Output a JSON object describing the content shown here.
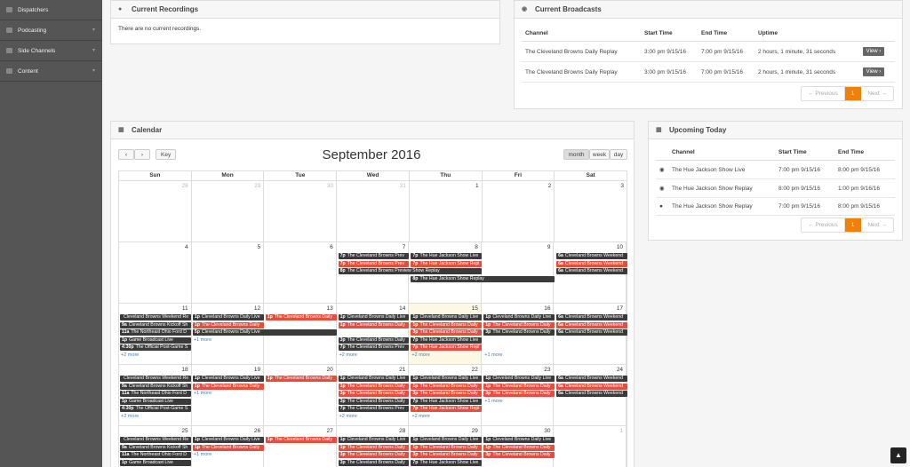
{
  "sidebar": {
    "items": [
      {
        "label": "Dispatchers",
        "icon": "dispatch-icon"
      },
      {
        "label": "Podcasting",
        "icon": "podcast-icon"
      },
      {
        "label": "Side Channels",
        "icon": "channel-icon"
      },
      {
        "label": "Content",
        "icon": "folder-icon"
      }
    ]
  },
  "recordings": {
    "title": "Current Recordings",
    "empty": "There are no current recordings."
  },
  "broadcasts": {
    "title": "Current Broadcasts",
    "headers": [
      "Channel",
      "Start Time",
      "End Time",
      "Uptime"
    ],
    "rows": [
      {
        "channel": "The Cleveland Browns Daily Replay",
        "start": "3:00 pm 9/15/16",
        "end": "7:00 pm 9/15/16",
        "uptime": "2 hours, 1 minute, 31 seconds",
        "action": "View"
      },
      {
        "channel": "The Cleveland Browns Daily Replay",
        "start": "3:00 pm 9/15/16",
        "end": "7:00 pm 9/15/16",
        "uptime": "2 hours, 1 minute, 31 seconds",
        "action": "View"
      }
    ],
    "pager": {
      "prev": "← Previous",
      "page": "1",
      "next": "Next →"
    }
  },
  "calendar": {
    "title": "Calendar",
    "month_title": "September 2016",
    "key_label": "Key",
    "prev": "‹",
    "next": "›",
    "views": [
      "month",
      "week",
      "day"
    ],
    "dow": [
      "Sun",
      "Mon",
      "Tue",
      "Wed",
      "Thu",
      "Fri",
      "Sat"
    ],
    "weeks": [
      [
        {
          "n": "28",
          "o": true
        },
        {
          "n": "29",
          "o": true
        },
        {
          "n": "30",
          "o": true
        },
        {
          "n": "31",
          "o": true
        },
        {
          "n": "1"
        },
        {
          "n": "2"
        },
        {
          "n": "3"
        }
      ],
      [
        {
          "n": "4"
        },
        {
          "n": "5"
        },
        {
          "n": "6"
        },
        {
          "n": "7"
        },
        {
          "n": "8"
        },
        {
          "n": "9"
        },
        {
          "n": "10"
        }
      ],
      [
        {
          "n": "11"
        },
        {
          "n": "12"
        },
        {
          "n": "13"
        },
        {
          "n": "14"
        },
        {
          "n": "15",
          "t": true
        },
        {
          "n": "16"
        },
        {
          "n": "17"
        }
      ],
      [
        {
          "n": "18"
        },
        {
          "n": "19"
        },
        {
          "n": "20"
        },
        {
          "n": "21"
        },
        {
          "n": "22"
        },
        {
          "n": "23"
        },
        {
          "n": "24"
        }
      ],
      [
        {
          "n": "25"
        },
        {
          "n": "26"
        },
        {
          "n": "27"
        },
        {
          "n": "28"
        },
        {
          "n": "29"
        },
        {
          "n": "30"
        },
        {
          "n": "1",
          "o": true
        }
      ]
    ],
    "events": [
      {
        "w": 1,
        "d": 3,
        "r": 0,
        "time": "7p",
        "text": "The Cleveland Browns Prev",
        "c": "dark"
      },
      {
        "w": 1,
        "d": 3,
        "r": 1,
        "time": "7p",
        "text": "The Cleveland Browns Prev",
        "c": "red"
      },
      {
        "w": 1,
        "d": 3,
        "r": 2,
        "time": "8p",
        "text": "The Cleveland Browns Preview Show Replay",
        "c": "dark",
        "span": 2
      },
      {
        "w": 1,
        "d": 4,
        "r": 0,
        "time": "7p",
        "text": "The Hue Jackson Show Live",
        "c": "dark"
      },
      {
        "w": 1,
        "d": 4,
        "r": 1,
        "time": "7p",
        "text": "The Hue Jackson Show Repl",
        "c": "red"
      },
      {
        "w": 1,
        "d": 4,
        "r": 3,
        "time": "8p",
        "text": "The Hue Jackson Show Replay",
        "c": "dark",
        "span": 2
      },
      {
        "w": 1,
        "d": 6,
        "r": 0,
        "time": "6a",
        "text": "Cleveland Browns Weekend",
        "c": "dark"
      },
      {
        "w": 1,
        "d": 6,
        "r": 1,
        "time": "6a",
        "text": "Cleveland Browns Weekend",
        "c": "red"
      },
      {
        "w": 1,
        "d": 6,
        "r": 2,
        "time": "6a",
        "text": "Cleveland Browns Weekend",
        "c": "dark"
      },
      {
        "w": 2,
        "d": 0,
        "r": 0,
        "time": "",
        "text": "Cleveland Browns Weekend Re",
        "c": "dark"
      },
      {
        "w": 2,
        "d": 0,
        "r": 1,
        "time": "9a",
        "text": "Cleveland Browns Kickoff Sh",
        "c": "dark"
      },
      {
        "w": 2,
        "d": 0,
        "r": 2,
        "time": "11a",
        "text": "The Northeast Ohio Ford D",
        "c": "dark"
      },
      {
        "w": 2,
        "d": 0,
        "r": 3,
        "time": "1p",
        "text": "Game Broadcast Live",
        "c": "dark"
      },
      {
        "w": 2,
        "d": 0,
        "r": 4,
        "time": "4:30p",
        "text": "The Official Post-Game S",
        "c": "dark"
      },
      {
        "w": 2,
        "d": 1,
        "r": 0,
        "time": "1p",
        "text": "Cleveland Browns Daily Live",
        "c": "dark"
      },
      {
        "w": 2,
        "d": 1,
        "r": 1,
        "time": "1p",
        "text": "The Cleveland Browns Daily",
        "c": "red"
      },
      {
        "w": 2,
        "d": 1,
        "r": 2,
        "time": "5p",
        "text": "Cleveland Browns Daily Live",
        "c": "dark",
        "span": 2
      },
      {
        "w": 2,
        "d": 2,
        "r": 0,
        "time": "1p",
        "text": "The Cleveland Browns Daily",
        "c": "red"
      },
      {
        "w": 2,
        "d": 3,
        "r": 0,
        "time": "1p",
        "text": "Cleveland Browns Daily Live",
        "c": "dark"
      },
      {
        "w": 2,
        "d": 3,
        "r": 1,
        "time": "1p",
        "text": "The Cleveland Browns Daily",
        "c": "red"
      },
      {
        "w": 2,
        "d": 3,
        "r": 3,
        "time": "3p",
        "text": "The Cleveland Browns Daily",
        "c": "dark"
      },
      {
        "w": 2,
        "d": 3,
        "r": 4,
        "time": "7p",
        "text": "The Cleveland Browns Prev",
        "c": "dark"
      },
      {
        "w": 2,
        "d": 4,
        "r": 0,
        "time": "1p",
        "text": "Cleveland Browns Daily Live",
        "c": "dark"
      },
      {
        "w": 2,
        "d": 4,
        "r": 1,
        "time": "1p",
        "text": "The Cleveland Browns Daily",
        "c": "red"
      },
      {
        "w": 2,
        "d": 4,
        "r": 2,
        "time": "3p",
        "text": "The Cleveland Browns Daily",
        "c": "red"
      },
      {
        "w": 2,
        "d": 4,
        "r": 3,
        "time": "7p",
        "text": "The Hue Jackson Show Live",
        "c": "dark"
      },
      {
        "w": 2,
        "d": 4,
        "r": 4,
        "time": "7p",
        "text": "The Hue Jackson Show Repl",
        "c": "red"
      },
      {
        "w": 2,
        "d": 5,
        "r": 0,
        "time": "1p",
        "text": "Cleveland Browns Daily Live",
        "c": "dark"
      },
      {
        "w": 2,
        "d": 5,
        "r": 1,
        "time": "1p",
        "text": "The Cleveland Browns Daily",
        "c": "red"
      },
      {
        "w": 2,
        "d": 5,
        "r": 2,
        "time": "3p",
        "text": "The Cleveland Browns Daily",
        "c": "dark"
      },
      {
        "w": 2,
        "d": 6,
        "r": 0,
        "time": "6a",
        "text": "Cleveland Browns Weekend",
        "c": "dark"
      },
      {
        "w": 2,
        "d": 6,
        "r": 1,
        "time": "6a",
        "text": "Cleveland Browns Weekend",
        "c": "red"
      },
      {
        "w": 2,
        "d": 6,
        "r": 2,
        "time": "6a",
        "text": "Cleveland Browns Weekend",
        "c": "dark"
      },
      {
        "w": 3,
        "d": 0,
        "r": 0,
        "time": "",
        "text": "Cleveland Browns Weekend Re",
        "c": "dark"
      },
      {
        "w": 3,
        "d": 0,
        "r": 1,
        "time": "9a",
        "text": "Cleveland Browns Kickoff Sh",
        "c": "dark"
      },
      {
        "w": 3,
        "d": 0,
        "r": 2,
        "time": "11a",
        "text": "The Northeast Ohio Ford D",
        "c": "dark"
      },
      {
        "w": 3,
        "d": 0,
        "r": 3,
        "time": "1p",
        "text": "Game Broadcast Live",
        "c": "dark"
      },
      {
        "w": 3,
        "d": 0,
        "r": 4,
        "time": "4:30p",
        "text": "The Official Post-Game S",
        "c": "dark"
      },
      {
        "w": 3,
        "d": 1,
        "r": 0,
        "time": "1p",
        "text": "Cleveland Browns Daily Live",
        "c": "dark"
      },
      {
        "w": 3,
        "d": 1,
        "r": 1,
        "time": "1p",
        "text": "The Cleveland Browns Daily",
        "c": "red"
      },
      {
        "w": 3,
        "d": 2,
        "r": 0,
        "time": "1p",
        "text": "The Cleveland Browns Daily",
        "c": "red"
      },
      {
        "w": 3,
        "d": 3,
        "r": 0,
        "time": "1p",
        "text": "Cleveland Browns Daily Live",
        "c": "dark"
      },
      {
        "w": 3,
        "d": 3,
        "r": 1,
        "time": "1p",
        "text": "The Cleveland Browns Daily",
        "c": "red"
      },
      {
        "w": 3,
        "d": 3,
        "r": 2,
        "time": "3p",
        "text": "The Cleveland Browns Daily",
        "c": "red"
      },
      {
        "w": 3,
        "d": 3,
        "r": 3,
        "time": "3p",
        "text": "The Cleveland Browns Daily",
        "c": "dark"
      },
      {
        "w": 3,
        "d": 3,
        "r": 4,
        "time": "7p",
        "text": "The Cleveland Browns Prev",
        "c": "dark"
      },
      {
        "w": 3,
        "d": 4,
        "r": 0,
        "time": "1p",
        "text": "Cleveland Browns Daily Live",
        "c": "dark"
      },
      {
        "w": 3,
        "d": 4,
        "r": 1,
        "time": "1p",
        "text": "The Cleveland Browns Daily",
        "c": "red"
      },
      {
        "w": 3,
        "d": 4,
        "r": 2,
        "time": "3p",
        "text": "The Cleveland Browns Daily",
        "c": "red"
      },
      {
        "w": 3,
        "d": 4,
        "r": 3,
        "time": "7p",
        "text": "The Hue Jackson Show Live",
        "c": "dark"
      },
      {
        "w": 3,
        "d": 4,
        "r": 4,
        "time": "7p",
        "text": "The Hue Jackson Show Repl",
        "c": "red"
      },
      {
        "w": 3,
        "d": 5,
        "r": 0,
        "time": "1p",
        "text": "Cleveland Browns Daily Live",
        "c": "dark"
      },
      {
        "w": 3,
        "d": 5,
        "r": 1,
        "time": "1p",
        "text": "The Cleveland Browns Daily",
        "c": "red"
      },
      {
        "w": 3,
        "d": 5,
        "r": 2,
        "time": "3p",
        "text": "The Cleveland Browns Daily",
        "c": "red"
      },
      {
        "w": 3,
        "d": 6,
        "r": 0,
        "time": "6a",
        "text": "Cleveland Browns Weekend",
        "c": "dark"
      },
      {
        "w": 3,
        "d": 6,
        "r": 1,
        "time": "6a",
        "text": "Cleveland Browns Weekend",
        "c": "red"
      },
      {
        "w": 3,
        "d": 6,
        "r": 2,
        "time": "6a",
        "text": "Cleveland Browns Weekend",
        "c": "dark"
      },
      {
        "w": 4,
        "d": 0,
        "r": 0,
        "time": "",
        "text": "Cleveland Browns Weekend Re",
        "c": "dark"
      },
      {
        "w": 4,
        "d": 0,
        "r": 1,
        "time": "9a",
        "text": "Cleveland Browns Kickoff Sh",
        "c": "dark"
      },
      {
        "w": 4,
        "d": 0,
        "r": 2,
        "time": "11a",
        "text": "The Northeast Ohio Ford D",
        "c": "dark"
      },
      {
        "w": 4,
        "d": 0,
        "r": 3,
        "time": "1p",
        "text": "Game Broadcast Live",
        "c": "dark"
      },
      {
        "w": 4,
        "d": 1,
        "r": 0,
        "time": "1p",
        "text": "Cleveland Browns Daily Live",
        "c": "dark"
      },
      {
        "w": 4,
        "d": 1,
        "r": 1,
        "time": "1p",
        "text": "The Cleveland Browns Daily",
        "c": "red"
      },
      {
        "w": 4,
        "d": 2,
        "r": 0,
        "time": "1p",
        "text": "The Cleveland Browns Daily",
        "c": "red"
      },
      {
        "w": 4,
        "d": 3,
        "r": 0,
        "time": "1p",
        "text": "Cleveland Browns Daily Live",
        "c": "dark"
      },
      {
        "w": 4,
        "d": 3,
        "r": 1,
        "time": "1p",
        "text": "The Cleveland Browns Daily",
        "c": "red"
      },
      {
        "w": 4,
        "d": 3,
        "r": 2,
        "time": "3p",
        "text": "The Cleveland Browns Daily",
        "c": "red"
      },
      {
        "w": 4,
        "d": 3,
        "r": 3,
        "time": "3p",
        "text": "The Cleveland Browns Daily",
        "c": "dark"
      },
      {
        "w": 4,
        "d": 4,
        "r": 0,
        "time": "1p",
        "text": "Cleveland Browns Daily Live",
        "c": "dark"
      },
      {
        "w": 4,
        "d": 4,
        "r": 1,
        "time": "1p",
        "text": "The Cleveland Browns Daily",
        "c": "red"
      },
      {
        "w": 4,
        "d": 4,
        "r": 2,
        "time": "3p",
        "text": "The Cleveland Browns Daily",
        "c": "red"
      },
      {
        "w": 4,
        "d": 4,
        "r": 3,
        "time": "7p",
        "text": "The Hue Jackson Show Live",
        "c": "dark"
      },
      {
        "w": 4,
        "d": 5,
        "r": 0,
        "time": "1p",
        "text": "Cleveland Browns Daily Live",
        "c": "dark"
      },
      {
        "w": 4,
        "d": 5,
        "r": 1,
        "time": "1p",
        "text": "The Cleveland Browns Daily",
        "c": "red"
      },
      {
        "w": 4,
        "d": 5,
        "r": 2,
        "time": "3p",
        "text": "The Cleveland Browns Daily",
        "c": "red"
      }
    ],
    "more": [
      {
        "w": 2,
        "d": 0,
        "r": 5,
        "text": "+2 more"
      },
      {
        "w": 2,
        "d": 1,
        "r": 3,
        "text": "+1 more"
      },
      {
        "w": 2,
        "d": 3,
        "r": 5,
        "text": "+2 more"
      },
      {
        "w": 2,
        "d": 4,
        "r": 5,
        "text": "+2 more"
      },
      {
        "w": 2,
        "d": 5,
        "r": 5,
        "text": "+1 more"
      },
      {
        "w": 3,
        "d": 0,
        "r": 5,
        "text": "+2 more"
      },
      {
        "w": 3,
        "d": 1,
        "r": 2,
        "text": "+1 more"
      },
      {
        "w": 3,
        "d": 3,
        "r": 5,
        "text": "+2 more"
      },
      {
        "w": 3,
        "d": 4,
        "r": 5,
        "text": "+2 more"
      },
      {
        "w": 3,
        "d": 5,
        "r": 3,
        "text": "+1 more"
      },
      {
        "w": 4,
        "d": 1,
        "r": 2,
        "text": "+1 more"
      }
    ]
  },
  "upcoming": {
    "title": "Upcoming Today",
    "headers": [
      "Channel",
      "Start Time",
      "End Time"
    ],
    "rows": [
      {
        "icon": "rss-icon",
        "channel": "The Hue Jackson Show Live",
        "start": "7:00 pm 9/15/16",
        "end": "8:00 pm 9/15/16"
      },
      {
        "icon": "rss-icon",
        "channel": "The Hue Jackson Show Replay",
        "start": "8:00 pm 9/15/16",
        "end": "1:00 pm 9/16/16"
      },
      {
        "icon": "record-icon",
        "channel": "The Hue Jackson Show Replay",
        "start": "7:00 pm 9/15/16",
        "end": "8:00 pm 9/15/16"
      }
    ],
    "pager": {
      "prev": "← Previous",
      "page": "1",
      "next": "Next →"
    }
  }
}
